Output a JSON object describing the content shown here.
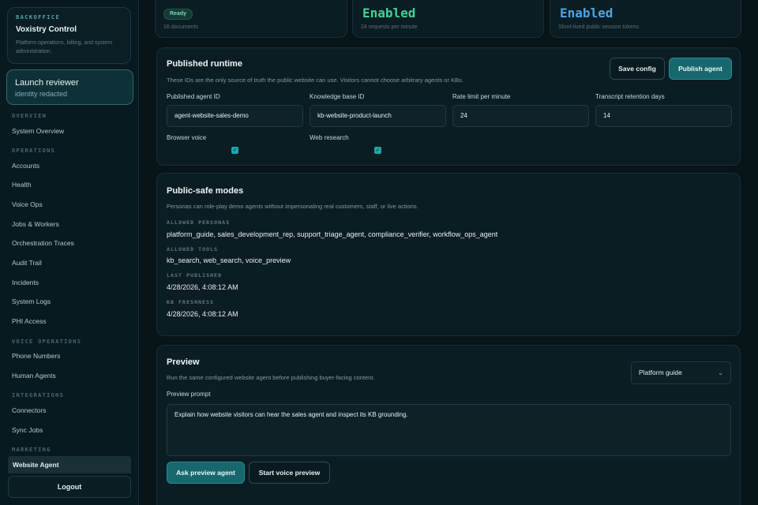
{
  "sidebar": {
    "brand": {
      "eyebrow": "BACKOFFICE",
      "title": "Voxistry Control",
      "description": "Platform operations, billing, and system administration."
    },
    "user": {
      "name": "Launch reviewer",
      "subtitle": "identity redacted"
    },
    "sections": [
      {
        "label": "OVERVIEW",
        "items": [
          "System Overview"
        ]
      },
      {
        "label": "OPERATIONS",
        "items": [
          "Accounts",
          "Health",
          "Voice Ops",
          "Jobs & Workers",
          "Orchestration Traces",
          "Audit Trail",
          "Incidents",
          "System Logs",
          "PHI Access"
        ]
      },
      {
        "label": "VOICE OPERATIONS",
        "items": [
          "Phone Numbers",
          "Human Agents"
        ]
      },
      {
        "label": "INTEGRATIONS",
        "items": [
          "Connectors",
          "Sync Jobs"
        ]
      },
      {
        "label": "MARKETING",
        "items": [
          "Website Agent"
        ]
      }
    ],
    "active_item": "Website Agent",
    "logout_label": "Logout"
  },
  "stats": [
    {
      "badge": "Ready",
      "subtitle": "16 documents"
    },
    {
      "value": "Enabled",
      "subtitle": "24 requests per minute",
      "color": "#3fd39a"
    },
    {
      "value": "Enabled",
      "subtitle": "Short-lived public session tokens",
      "color": "#4fa3e6"
    }
  ],
  "runtime": {
    "title": "Published runtime",
    "description": "These IDs are the only source of truth the public website can use. Visitors cannot choose arbitrary agents or KBs.",
    "save_label": "Save config",
    "publish_label": "Publish agent",
    "fields": [
      {
        "label": "Published agent ID",
        "value": "agent-website-sales-demo"
      },
      {
        "label": "Knowledge base ID",
        "value": "kb-website-product-launch"
      },
      {
        "label": "Rate limit per minute",
        "value": "24"
      },
      {
        "label": "Transcript retention days",
        "value": "14"
      }
    ],
    "checkboxes": [
      {
        "label": "Browser voice",
        "checked": true
      },
      {
        "label": "Web research",
        "checked": true
      }
    ]
  },
  "modes": {
    "title": "Public-safe modes",
    "description": "Personas can role-play demo agents without impersonating real customers, staff, or live actions.",
    "allowed_personas_label": "ALLOWED PERSONAS",
    "allowed_personas": "platform_guide, sales_development_rep, support_triage_agent, compliance_verifier, workflow_ops_agent",
    "allowed_tools_label": "ALLOWED TOOLS",
    "allowed_tools": "kb_search, web_search, voice_preview",
    "last_published_label": "LAST PUBLISHED",
    "last_published": "4/28/2026, 4:08:12 AM",
    "kb_freshness_label": "KB FRESHNESS",
    "kb_freshness": "4/28/2026, 4:08:12 AM"
  },
  "preview": {
    "title": "Preview",
    "description": "Run the same configured website agent before publishing buyer-facing content.",
    "persona_select": "Platform guide",
    "prompt_label": "Preview prompt",
    "prompt_value": "Explain how website visitors can hear the sales agent and inspect its KB grounding.",
    "ask_label": "Ask preview agent",
    "voice_label": "Start voice preview"
  }
}
